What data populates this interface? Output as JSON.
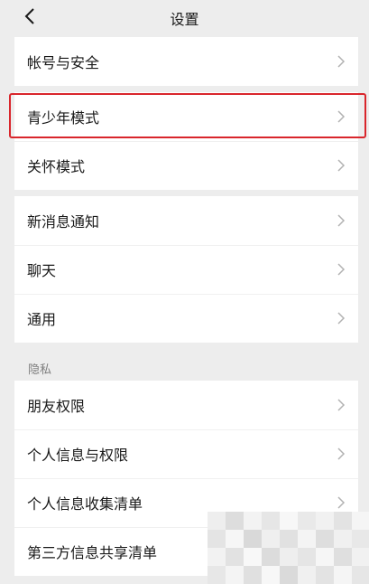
{
  "header": {
    "title": "设置",
    "back_icon": "chevron-left-icon"
  },
  "groups": [
    {
      "items": [
        {
          "label": "帐号与安全"
        }
      ]
    },
    {
      "items": [
        {
          "label": "青少年模式"
        },
        {
          "label": "关怀模式"
        }
      ]
    },
    {
      "items": [
        {
          "label": "新消息通知"
        },
        {
          "label": "聊天"
        },
        {
          "label": "通用"
        }
      ]
    }
  ],
  "privacy": {
    "section_title": "隐私",
    "items": [
      {
        "label": "朋友权限"
      },
      {
        "label": "个人信息与权限"
      },
      {
        "label": "个人信息收集清单"
      },
      {
        "label": "第三方信息共享清单"
      }
    ]
  },
  "colors": {
    "background": "#ededed",
    "card": "#ffffff",
    "text": "#191919",
    "section_text": "#7f7f7f",
    "chevron": "#b2b2b2",
    "highlight": "#d9262c"
  }
}
